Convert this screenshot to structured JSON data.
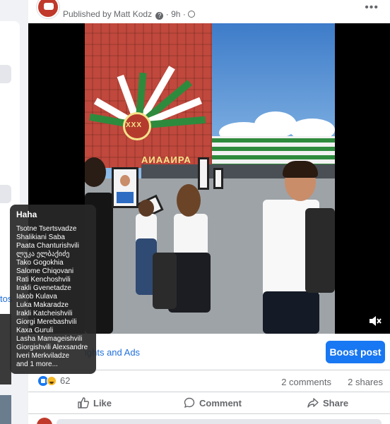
{
  "post": {
    "published_text": "Published by Matt Kodz",
    "separator": "·",
    "time": "9h",
    "more_label": "•••"
  },
  "sidebar": {
    "link_fragment": "tos"
  },
  "video": {
    "banner_year": "XXX",
    "banner_text": "АИААИРА",
    "mute_icon": "speaker-muted-icon"
  },
  "reactions_tooltip": {
    "title": "Haha",
    "names": [
      "Tsotne Tsertsvadze",
      "Shalikiani Saba",
      "Paata Chanturishvili",
      "ლუკა ელბაქიძე",
      "Tako Gogokhia",
      "Salome Chiqovani",
      "Rati Kenchoshvili",
      "Irakli Gvenetadze",
      "Iakob Kulava",
      "Luka Makaradze",
      "Irakli Katcheishvili",
      "Giorgi Merebashvili",
      "Kaxa Guruli",
      "Lasha Mamageishvili",
      "Giorgishvili Alexsandre",
      "Iveri Merkviladze",
      "and 1 more..."
    ]
  },
  "ads": {
    "see_ads_label": "ights and Ads",
    "boost_label": "Boost post"
  },
  "stats": {
    "reaction_count": "62",
    "comments": "2 comments",
    "shares": "2 shares"
  },
  "actions": {
    "like": "Like",
    "comment": "Comment",
    "share": "Share"
  },
  "colors": {
    "primary": "#1877f2",
    "secondary_text": "#65676b",
    "background": "#f0f2f5"
  }
}
